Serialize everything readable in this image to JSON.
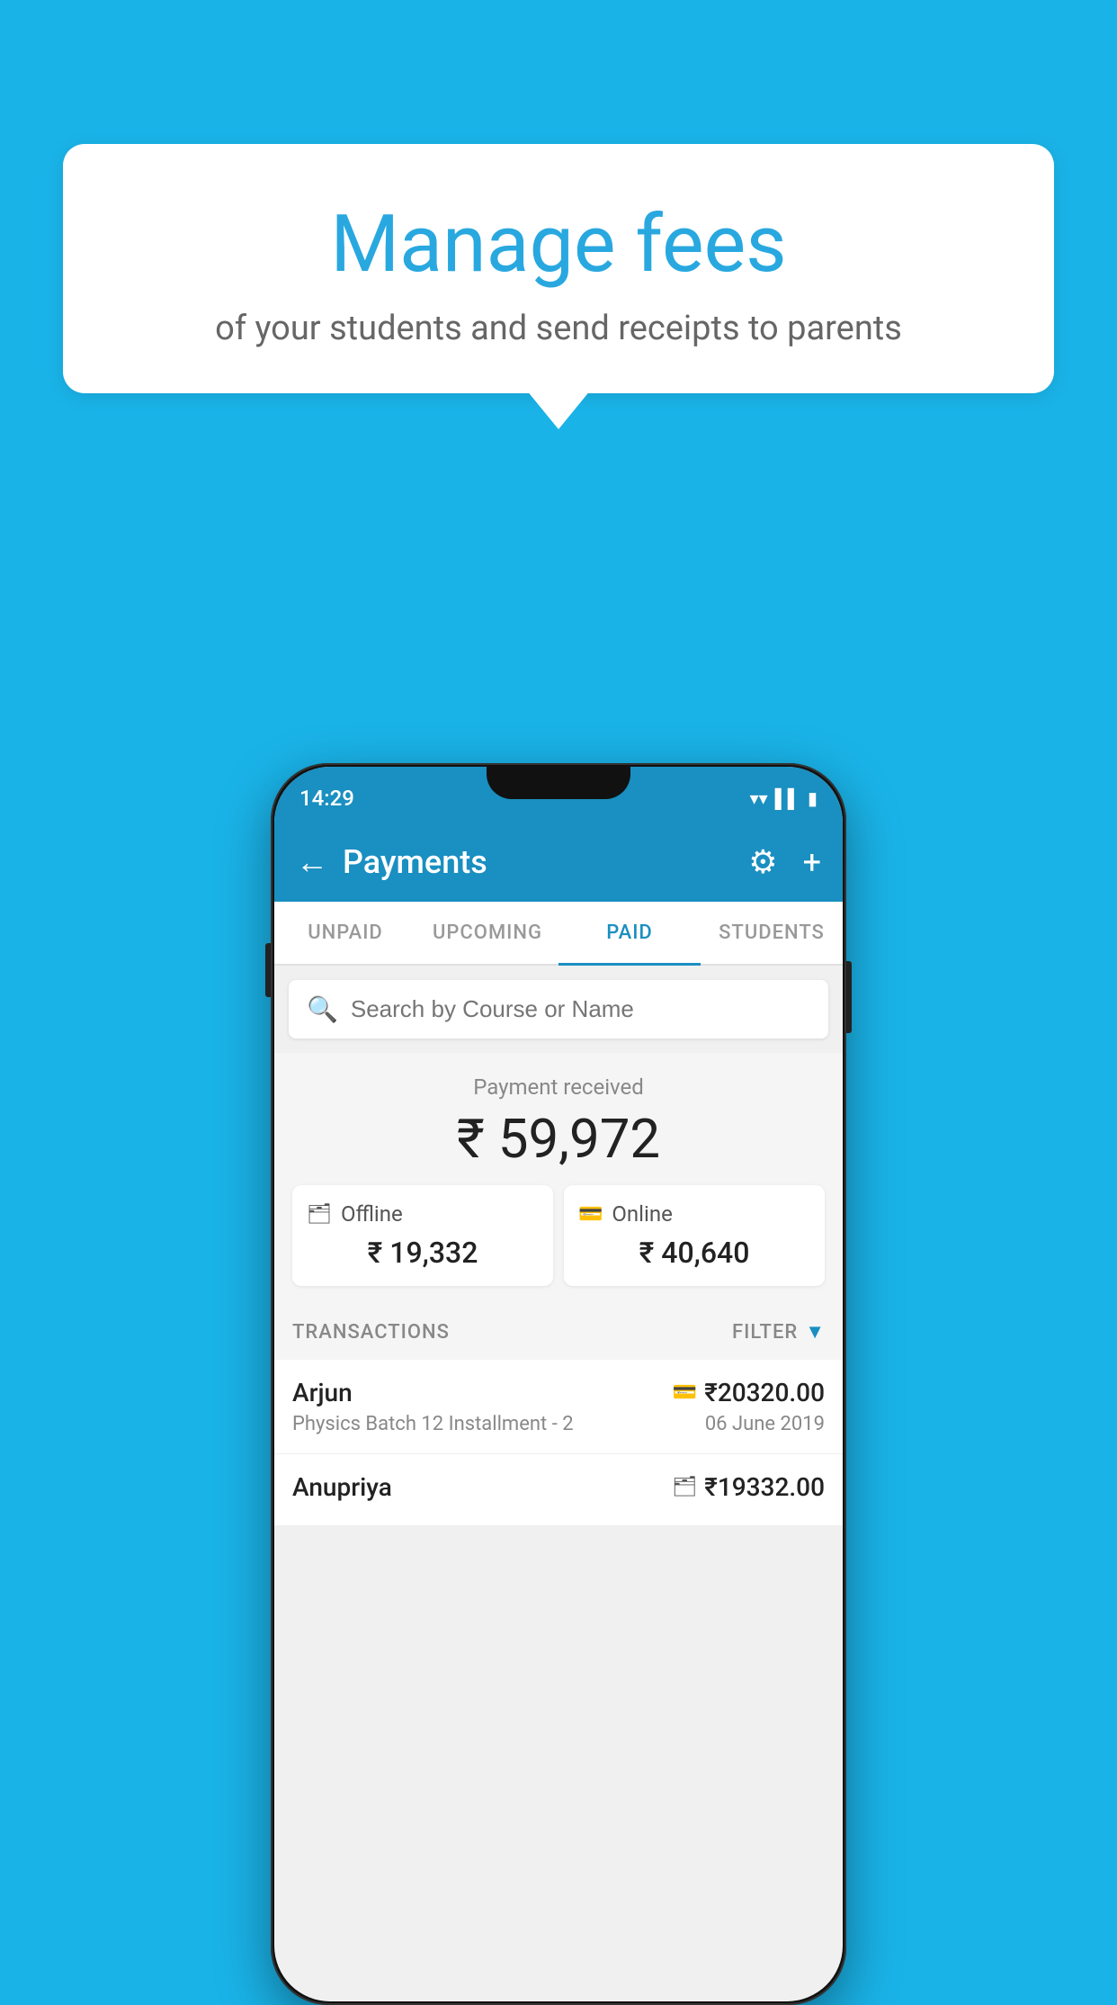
{
  "background_color": "#1ab3e8",
  "bubble": {
    "title": "Manage fees",
    "subtitle": "of your students and send receipts to parents"
  },
  "status_bar": {
    "time": "14:29",
    "icons": [
      "wifi",
      "signal",
      "battery"
    ]
  },
  "app_bar": {
    "title": "Payments",
    "back_label": "←",
    "settings_label": "⚙",
    "add_label": "+"
  },
  "tabs": [
    {
      "label": "UNPAID",
      "active": false
    },
    {
      "label": "UPCOMING",
      "active": false
    },
    {
      "label": "PAID",
      "active": true
    },
    {
      "label": "STUDENTS",
      "active": false
    }
  ],
  "search": {
    "placeholder": "Search by Course or Name"
  },
  "payment_summary": {
    "label": "Payment received",
    "total": "₹ 59,972",
    "offline": {
      "type": "Offline",
      "amount": "₹ 19,332",
      "icon": "💵"
    },
    "online": {
      "type": "Online",
      "amount": "₹ 40,640",
      "icon": "💳"
    }
  },
  "transactions": {
    "label": "TRANSACTIONS",
    "filter_label": "FILTER",
    "items": [
      {
        "name": "Arjun",
        "course": "Physics Batch 12 Installment - 2",
        "amount": "₹20320.00",
        "date": "06 June 2019",
        "icon": "💳"
      },
      {
        "name": "Anupriya",
        "course": "",
        "amount": "₹19332.00",
        "date": "",
        "icon": "💵"
      }
    ]
  }
}
